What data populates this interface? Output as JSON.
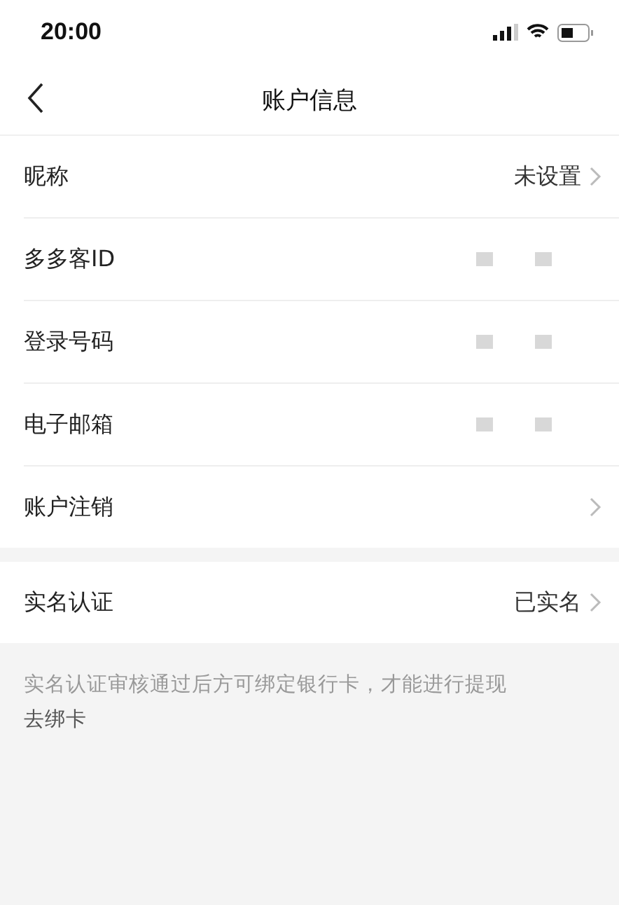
{
  "status_bar": {
    "time": "20:00"
  },
  "nav": {
    "title": "账户信息"
  },
  "sections": [
    {
      "rows": [
        {
          "label": "昵称",
          "value": "未设置",
          "redacted": false,
          "chevron": true
        },
        {
          "label": "多多客ID",
          "redacted": true,
          "chevron": false
        },
        {
          "label": "登录号码",
          "redacted": true,
          "chevron": false
        },
        {
          "label": "电子邮箱",
          "redacted": true,
          "chevron": false
        },
        {
          "label": "账户注销",
          "redacted": false,
          "chevron": true
        }
      ]
    },
    {
      "rows": [
        {
          "label": "实名认证",
          "value": "已实名",
          "redacted": false,
          "chevron": true
        }
      ]
    }
  ],
  "note": {
    "text": "实名认证审核通过后方可绑定银行卡，才能进行提现",
    "link": "去绑卡"
  }
}
